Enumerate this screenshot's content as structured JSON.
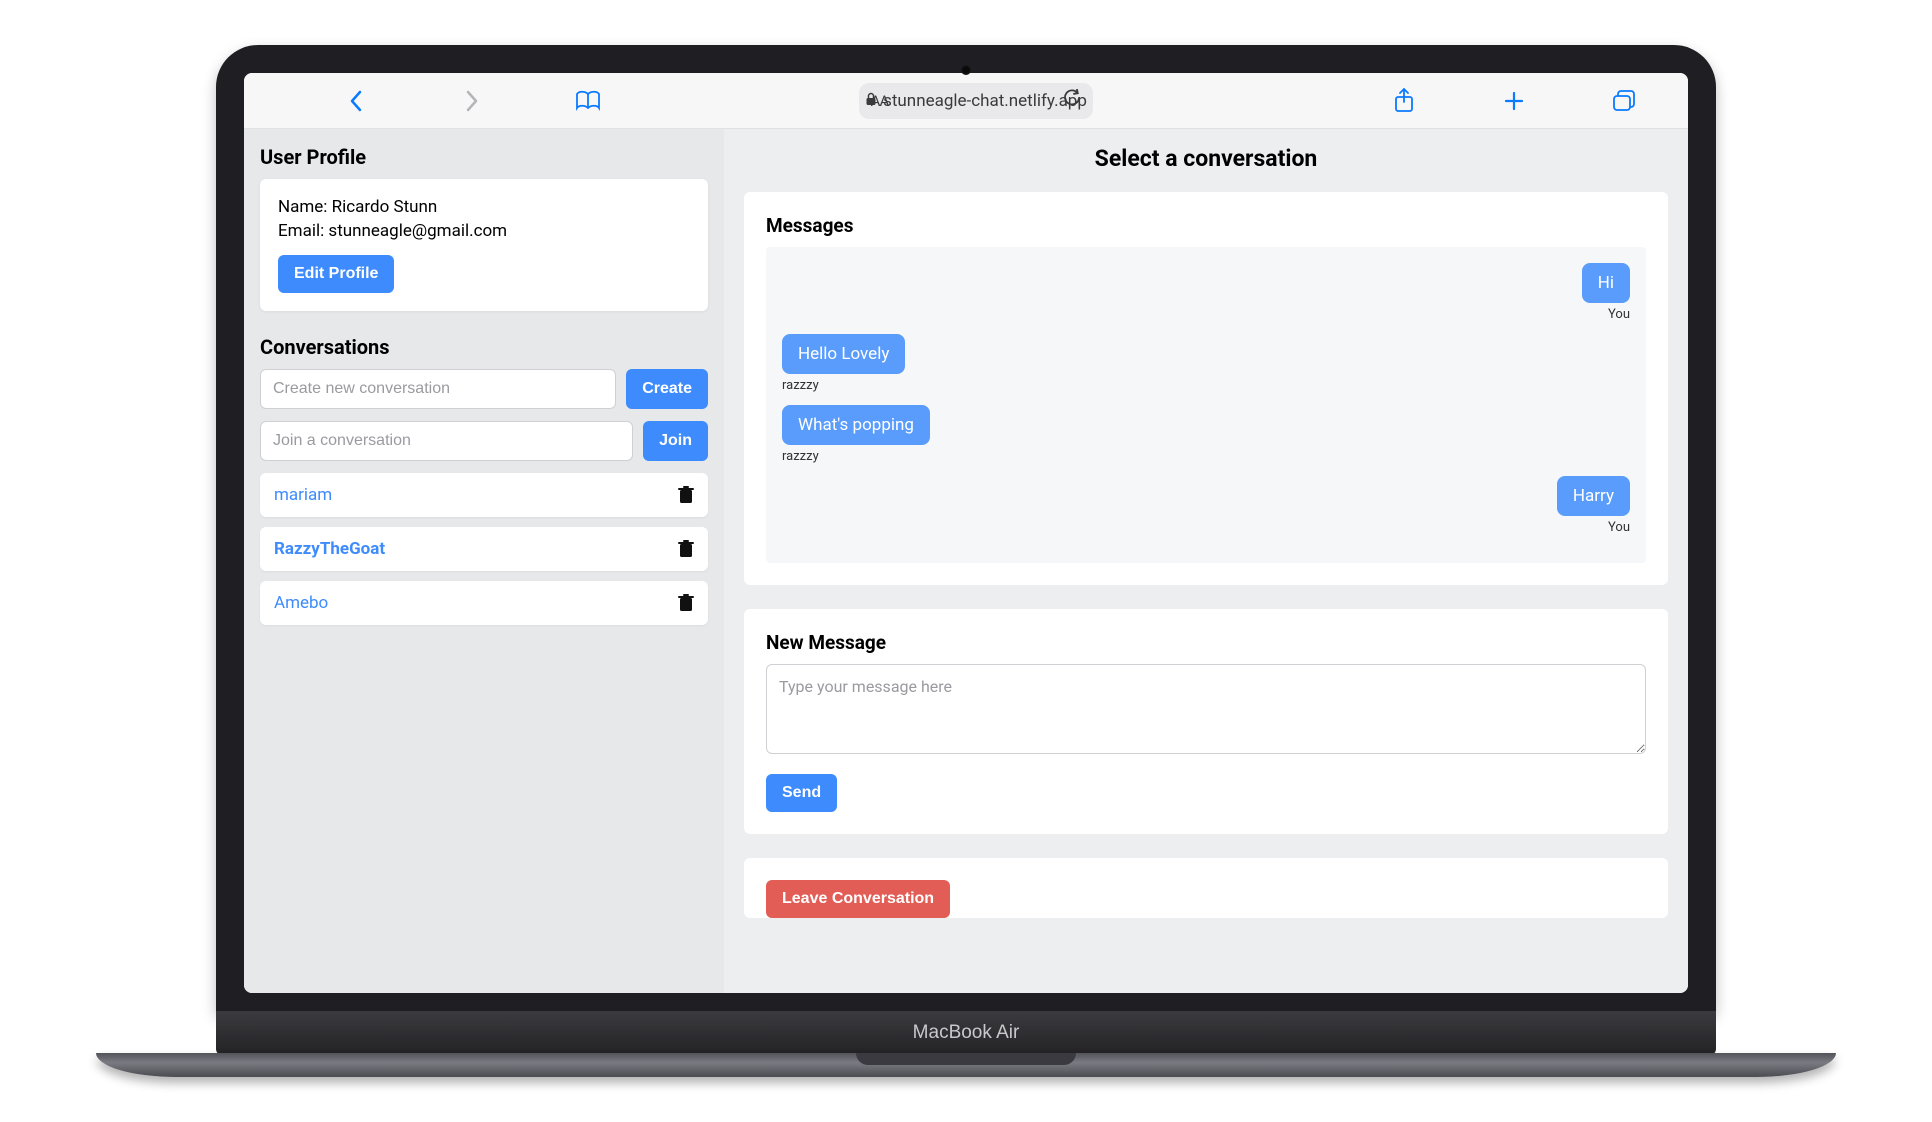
{
  "browser": {
    "url": "stunneagle-chat.netlify.app",
    "aa_label": "AA"
  },
  "sidebar": {
    "profile_title": "User Profile",
    "name_label": "Name:",
    "name_value": "Ricardo Stunn",
    "email_label": "Email:",
    "email_value": "stunneagle@gmail.com",
    "edit_profile_label": "Edit Profile",
    "conversations_title": "Conversations",
    "create_placeholder": "Create new conversation",
    "create_label": "Create",
    "join_placeholder": "Join a conversation",
    "join_label": "Join",
    "conversations": [
      {
        "name": "mariam",
        "bold": false
      },
      {
        "name": "RazzyTheGoat",
        "bold": true
      },
      {
        "name": "Amebo",
        "bold": false
      }
    ]
  },
  "main": {
    "title": "Select a conversation",
    "messages_title": "Messages",
    "messages": [
      {
        "text": "Hi",
        "sender": "You",
        "side": "right"
      },
      {
        "text": "Hello Lovely",
        "sender": "razzzy",
        "side": "left"
      },
      {
        "text": "What's popping",
        "sender": "razzzy",
        "side": "left"
      },
      {
        "text": "Harry",
        "sender": "You",
        "side": "right"
      }
    ],
    "new_message_title": "New Message",
    "message_placeholder": "Type your message here",
    "send_label": "Send",
    "leave_label": "Leave Conversation"
  },
  "device": {
    "label": "MacBook Air"
  }
}
